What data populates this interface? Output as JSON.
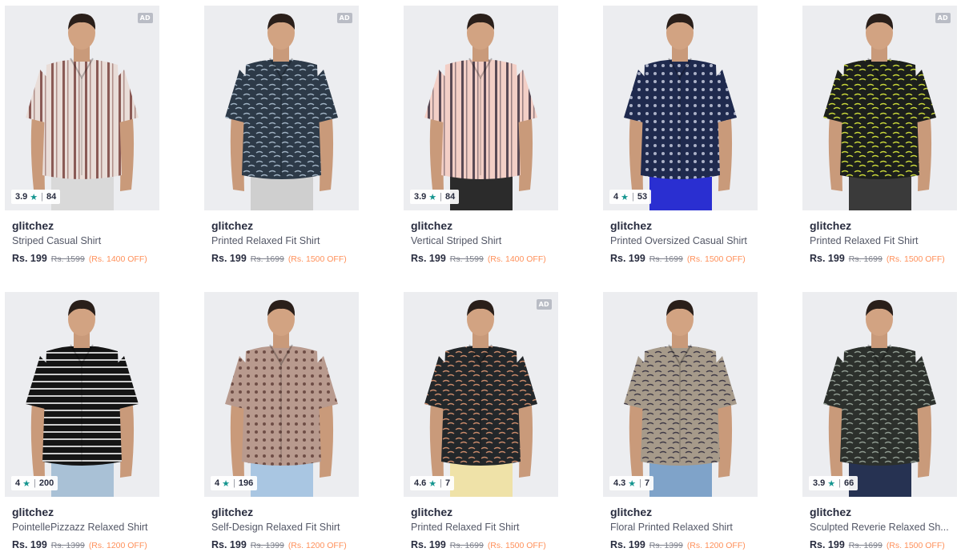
{
  "products": [
    {
      "brand": "glitchez",
      "name": "Striped Casual Shirt",
      "price": "Rs. 199",
      "mrp": "Rs. 1599",
      "discount": "(Rs. 1400 OFF)",
      "rating": "3.9",
      "reviews": "84",
      "ad": "AD",
      "shirt_color": "#e9ddd8",
      "stripe_color": "#8a5a55",
      "pattern": "vstripe",
      "pants_color": "#d9d9d9"
    },
    {
      "brand": "glitchez",
      "name": "Printed Relaxed Fit Shirt",
      "price": "Rs. 199",
      "mrp": "Rs. 1699",
      "discount": "(Rs. 1500 OFF)",
      "rating": "",
      "reviews": "",
      "ad": "AD",
      "shirt_color": "#2d3a48",
      "stripe_color": "#9fb1c2",
      "pattern": "print",
      "pants_color": "#cfcfcf"
    },
    {
      "brand": "glitchez",
      "name": "Vertical Striped Shirt",
      "price": "Rs. 199",
      "mrp": "Rs. 1599",
      "discount": "(Rs. 1400 OFF)",
      "rating": "3.9",
      "reviews": "84",
      "ad": "",
      "shirt_color": "#f3cfc6",
      "stripe_color": "#5a4a55",
      "pattern": "vstripe",
      "pants_color": "#2b2b2b"
    },
    {
      "brand": "glitchez",
      "name": "Printed Oversized Casual Shirt",
      "price": "Rs. 199",
      "mrp": "Rs. 1699",
      "discount": "(Rs. 1500 OFF)",
      "rating": "4",
      "reviews": "53",
      "ad": "",
      "shirt_color": "#1f2a4e",
      "stripe_color": "#cfd5e6",
      "pattern": "dots",
      "pants_color": "#2a2fd1"
    },
    {
      "brand": "glitchez",
      "name": "Printed Relaxed Fit Shirt",
      "price": "Rs. 199",
      "mrp": "Rs. 1699",
      "discount": "(Rs. 1500 OFF)",
      "rating": "",
      "reviews": "",
      "ad": "AD",
      "shirt_color": "#1c1f1c",
      "stripe_color": "#c8d63a",
      "pattern": "print",
      "pants_color": "#3a3a3a"
    },
    {
      "brand": "glitchez",
      "name": "PointellePizzazz Relaxed Shirt",
      "price": "Rs. 199",
      "mrp": "Rs. 1399",
      "discount": "(Rs. 1200 OFF)",
      "rating": "4",
      "reviews": "200",
      "ad": "",
      "shirt_color": "#151515",
      "stripe_color": "#cfcfcf",
      "pattern": "hstripe",
      "pants_color": "#a9c1d6"
    },
    {
      "brand": "glitchez",
      "name": "Self-Design Relaxed Fit Shirt",
      "price": "Rs. 199",
      "mrp": "Rs. 1399",
      "discount": "(Rs. 1200 OFF)",
      "rating": "4",
      "reviews": "196",
      "ad": "",
      "shirt_color": "#b89a8e",
      "stripe_color": "#5d3b35",
      "pattern": "dots",
      "pants_color": "#a9c6e2"
    },
    {
      "brand": "glitchez",
      "name": "Printed Relaxed Fit Shirt",
      "price": "Rs. 199",
      "mrp": "Rs. 1699",
      "discount": "(Rs. 1500 OFF)",
      "rating": "4.6",
      "reviews": "7",
      "ad": "AD",
      "shirt_color": "#23272a",
      "stripe_color": "#c98a6a",
      "pattern": "print",
      "pants_color": "#efe2a8"
    },
    {
      "brand": "glitchez",
      "name": "Floral Printed Relaxed Shirt",
      "price": "Rs. 199",
      "mrp": "Rs. 1399",
      "discount": "(Rs. 1200 OFF)",
      "rating": "4.3",
      "reviews": "7",
      "ad": "",
      "shirt_color": "#a69a8a",
      "stripe_color": "#3f3a46",
      "pattern": "print",
      "pants_color": "#7fa3c9"
    },
    {
      "brand": "glitchez",
      "name": "Sculpted Reverie Relaxed Sh...",
      "price": "Rs. 199",
      "mrp": "Rs. 1699",
      "discount": "(Rs. 1500 OFF)",
      "rating": "3.9",
      "reviews": "66",
      "ad": "",
      "shirt_color": "#2c302c",
      "stripe_color": "#8f9a90",
      "pattern": "print",
      "pants_color": "#263252"
    }
  ],
  "colors": {
    "star": "#14958f",
    "discount": "#ff905a",
    "mrp": "#7e818c",
    "text": "#282c3f"
  },
  "icons": {
    "star": "star-icon"
  }
}
